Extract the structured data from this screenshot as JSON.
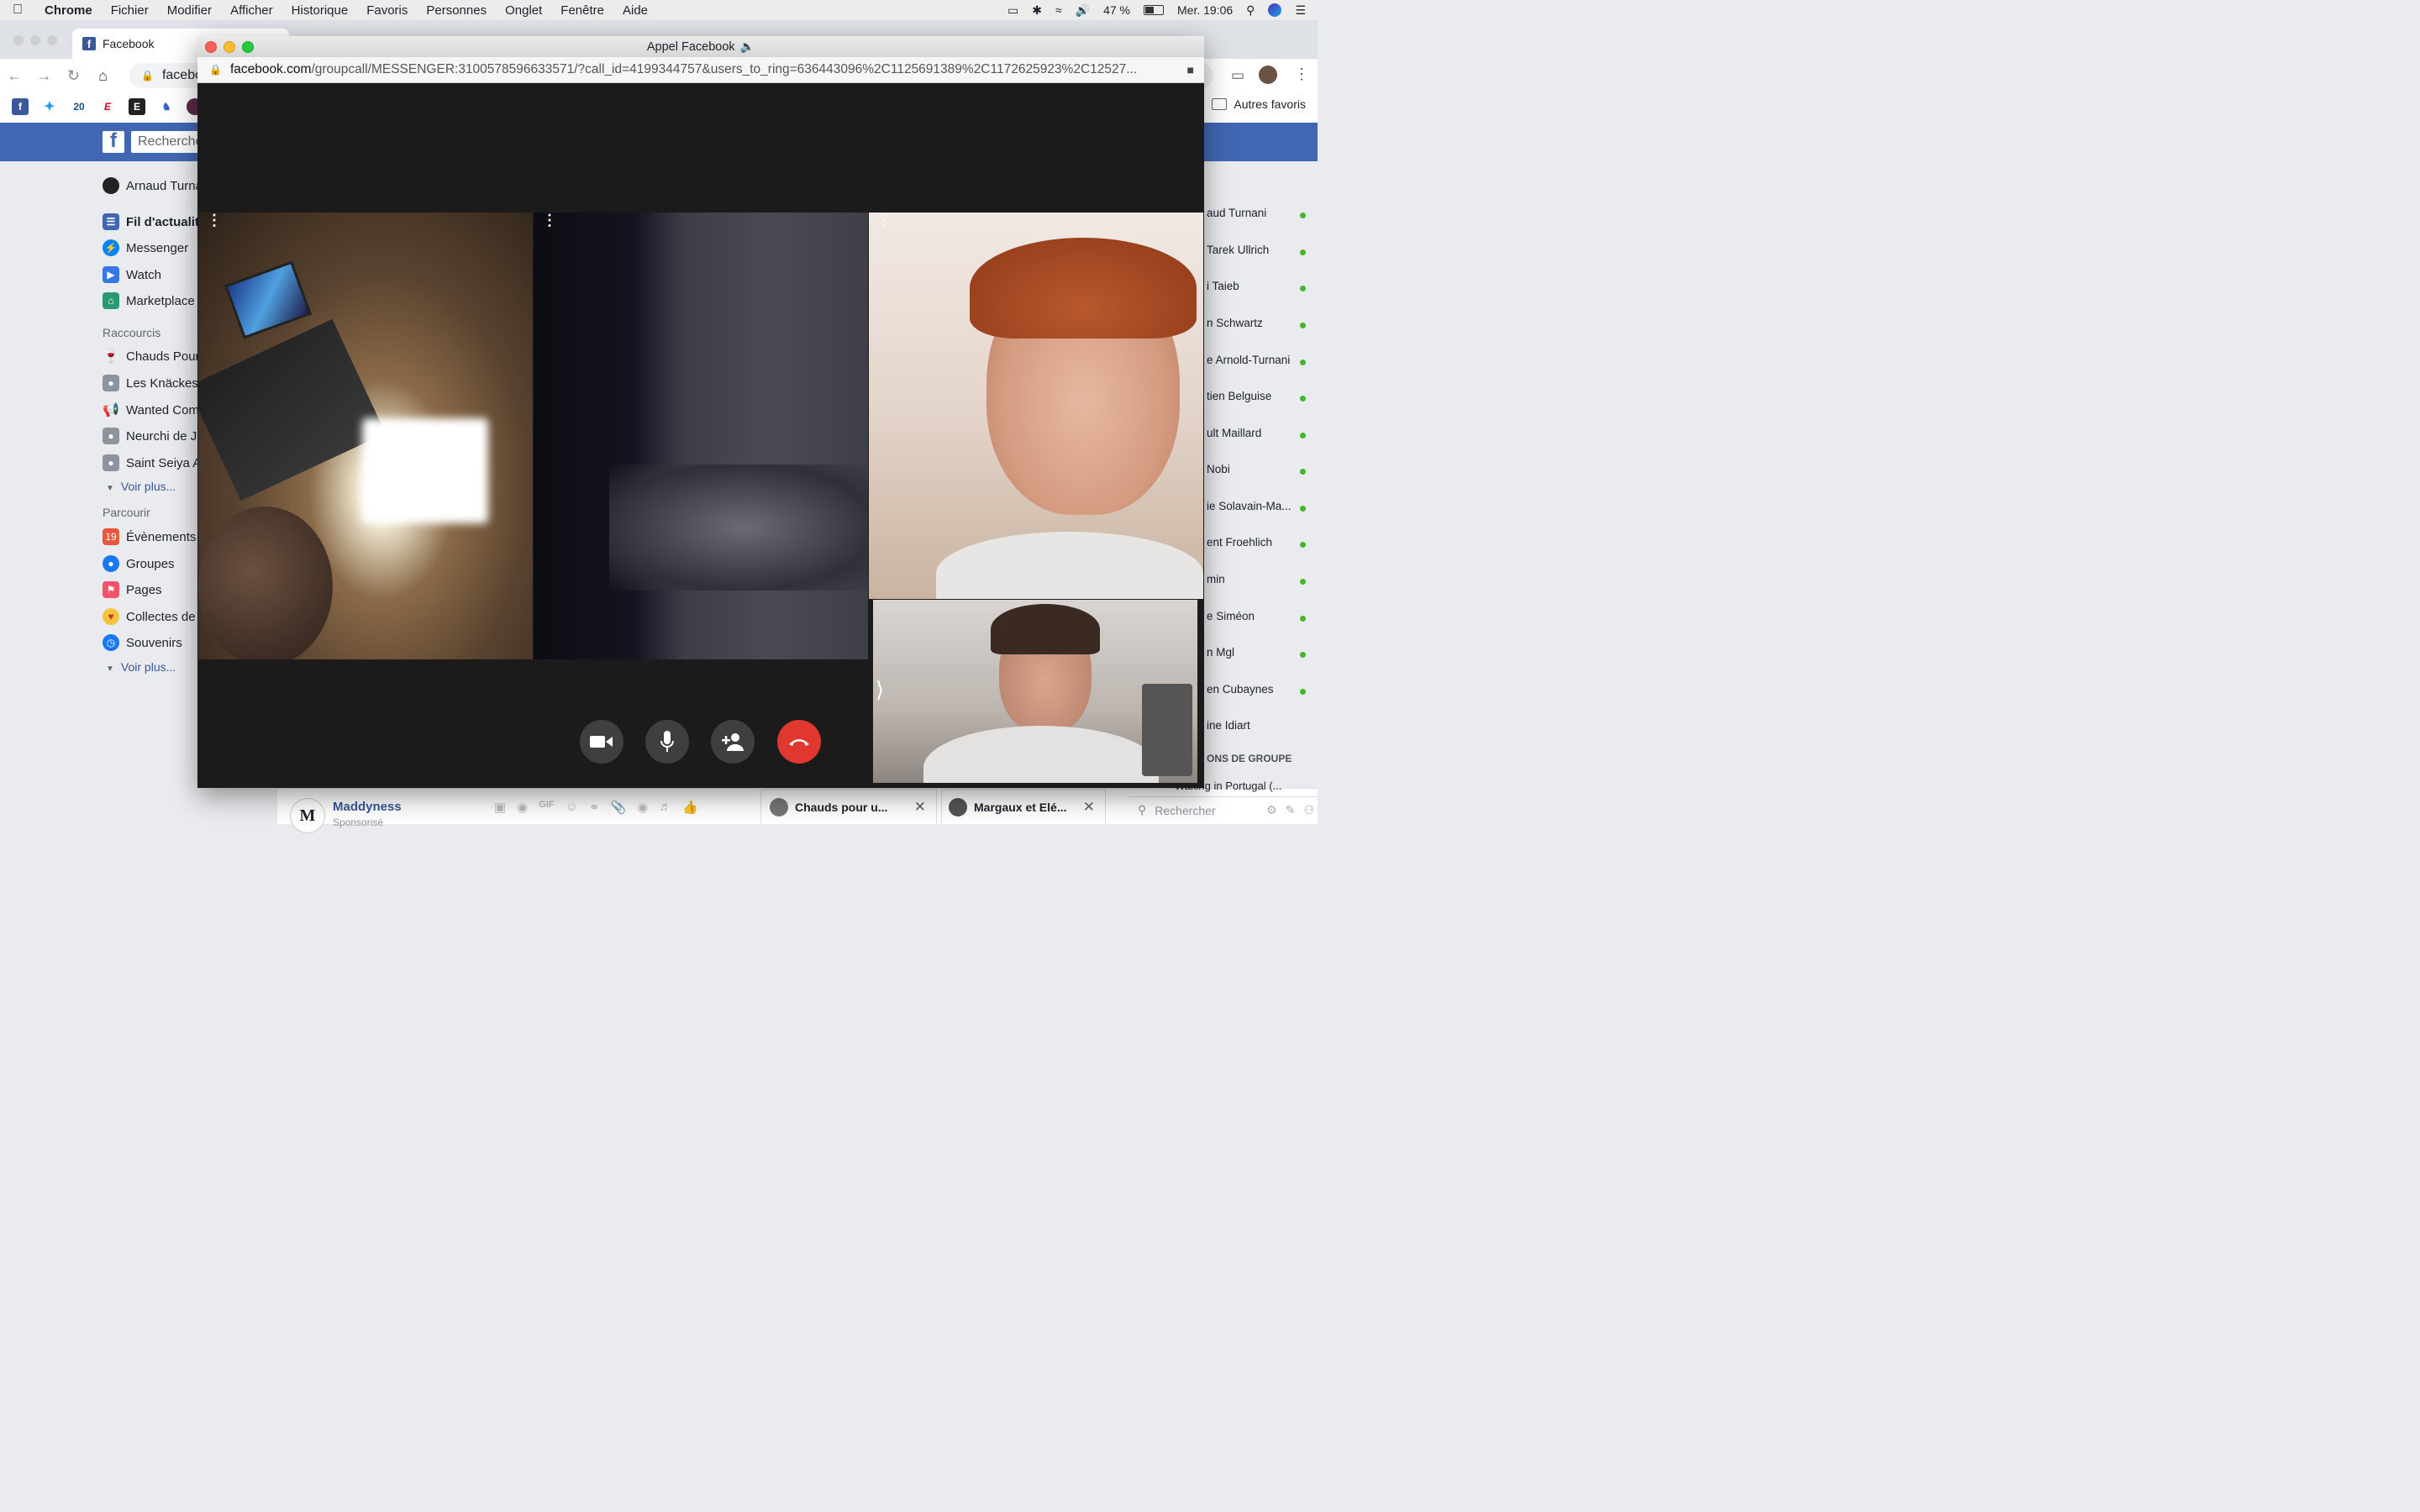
{
  "menubar": {
    "app": "Chrome",
    "items": [
      "Fichier",
      "Modifier",
      "Afficher",
      "Historique",
      "Favoris",
      "Personnes",
      "Onglet",
      "Fenêtre",
      "Aide"
    ],
    "battery": "47 %",
    "clock": "Mer. 19:06"
  },
  "browser": {
    "tab_title": "Facebook",
    "omnibox": "facebo",
    "bookmark_other": "Autres favoris"
  },
  "facebook": {
    "search_placeholder": "Recherche",
    "profile_name": "Arnaud Turna",
    "nav": [
      "Fil d'actualité",
      "Messenger",
      "Watch",
      "Marketplace"
    ],
    "shortcuts_header": "Raccourcis",
    "shortcuts": [
      "Chauds Pour",
      "Les Knäckes",
      "Wanted Com",
      "Neurchi de Je",
      "Saint Seiya A"
    ],
    "see_more": "Voir plus...",
    "explore_header": "Parcourir",
    "explore": [
      "Évènements",
      "Groupes",
      "Pages",
      "Collectes de",
      "Souvenirs"
    ],
    "contacts": [
      "aud Turnani",
      "Tarek Ullrich",
      "i Taieb",
      "n Schwartz",
      "e Arnold-Turnani",
      "tien Belguise",
      "ult Maillard",
      "Nobi",
      "ie Solavain-Ma...",
      "ent Froehlich",
      "min",
      "e Siméon",
      "n Mgl",
      "en Cubaynes",
      "ine Idiart"
    ],
    "group_conv_header": "ONS DE GROUPE",
    "group_conv_item": "Waking in Portugal (...",
    "chat_search": "Rechercher",
    "ad_name": "Maddyness",
    "ad_sub": "Sponsorisé",
    "chat_tab_1": "Chauds pour u...",
    "chat_tab_2": "Margaux et Elé..."
  },
  "call": {
    "window_title": "Appel Facebook",
    "url_host": "facebook.com",
    "url_path": "/groupcall/MESSENGER:3100578596633571/?call_id=4199344757&users_to_ring=636443096%2C1125691389%2C1172625923%2C12527..."
  },
  "colors": {
    "fb_blue": "#4267b2",
    "end_call": "#e0372e",
    "online": "#42b72a"
  }
}
